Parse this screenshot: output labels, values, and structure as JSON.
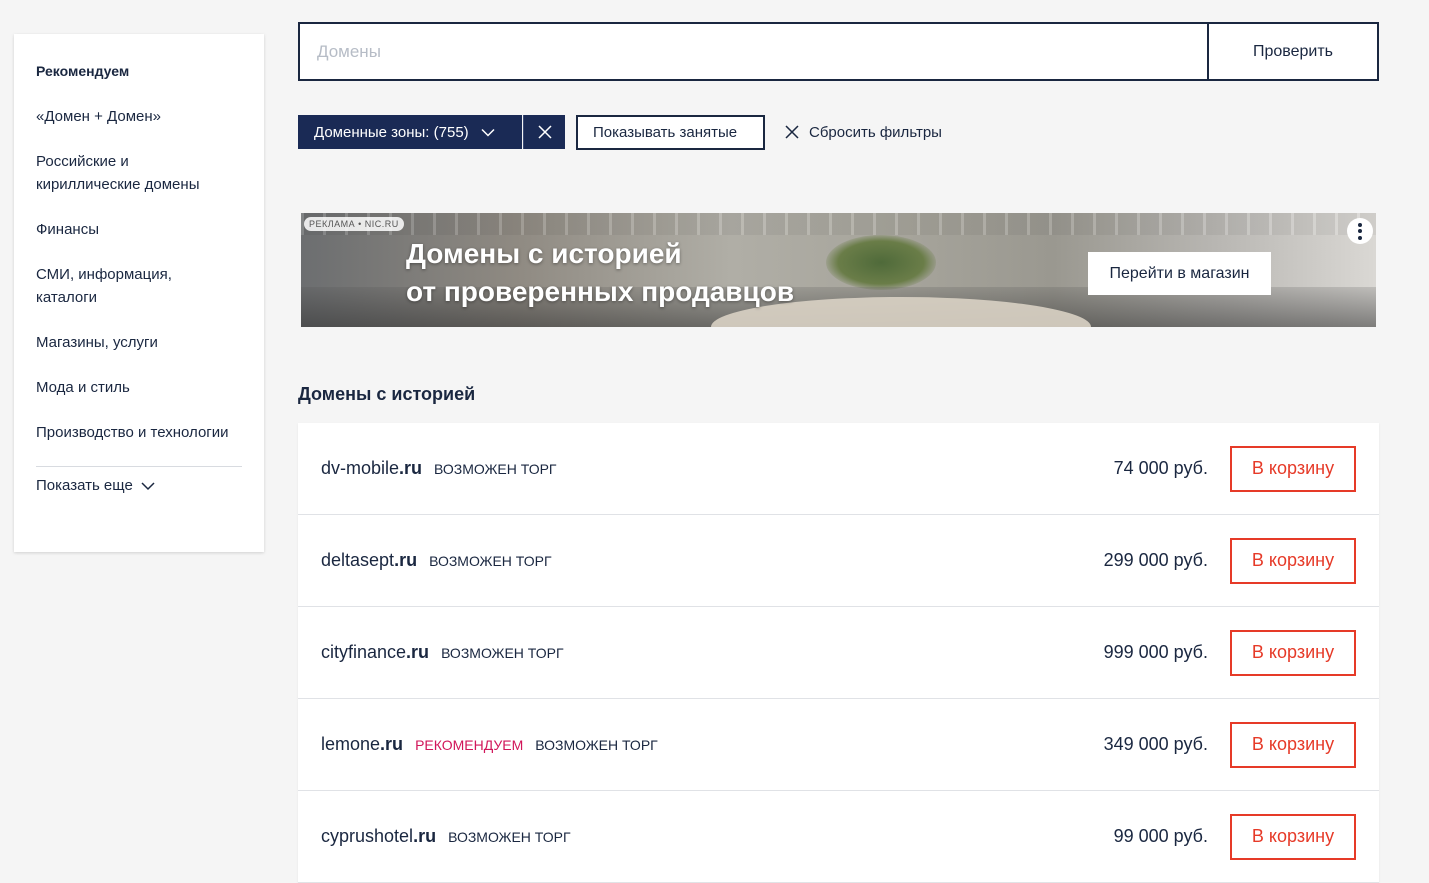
{
  "sidebar": {
    "items": [
      {
        "label": "Рекомендуем",
        "active": true
      },
      {
        "label": "«Домен + Домен»"
      },
      {
        "label": "Российские и кириллические домены"
      },
      {
        "label": "Финансы"
      },
      {
        "label": "СМИ, информация, каталоги"
      },
      {
        "label": "Магазины, услуги"
      },
      {
        "label": "Мода и стиль"
      },
      {
        "label": "Производство и технологии"
      }
    ],
    "more_label": "Показать еще"
  },
  "search": {
    "placeholder": "Домены",
    "value": "",
    "button_label": "Проверить"
  },
  "filters": {
    "zones_label": "Доменные зоны: (755)",
    "show_busy_label": "Показывать занятые",
    "reset_label": "Сбросить фильтры"
  },
  "banner": {
    "ad_label": "РЕКЛАМА • NIC.RU",
    "title_line1": "Домены с историей",
    "title_line2": "от проверенных продавцов",
    "button_label": "Перейти в магазин"
  },
  "section": {
    "title": "Домены с историей"
  },
  "domains": [
    {
      "name": "dv-mobile",
      "tld": ".ru",
      "tags": [
        "ВОЗМОЖЕН ТОРГ"
      ],
      "recommended": false,
      "price": "74 000 руб.",
      "cart_label": "В корзину"
    },
    {
      "name": "deltasept",
      "tld": ".ru",
      "tags": [
        "ВОЗМОЖЕН ТОРГ"
      ],
      "recommended": false,
      "price": "299 000 руб.",
      "cart_label": "В корзину"
    },
    {
      "name": "cityfinance",
      "tld": ".ru",
      "tags": [
        "ВОЗМОЖЕН ТОРГ"
      ],
      "recommended": false,
      "price": "999 000 руб.",
      "cart_label": "В корзину"
    },
    {
      "name": "lemone",
      "tld": ".ru",
      "tags": [
        "ВОЗМОЖЕН ТОРГ"
      ],
      "recommended": true,
      "recommended_label": "РЕКОМЕНДУЕМ",
      "price": "349 000 руб.",
      "cart_label": "В корзину"
    },
    {
      "name": "cyprushotel",
      "tld": ".ru",
      "tags": [
        "ВОЗМОЖЕН ТОРГ"
      ],
      "recommended": false,
      "price": "99 000 руб.",
      "cart_label": "В корзину"
    }
  ],
  "colors": {
    "navy": "#1a2a55",
    "text": "#1a2740",
    "cart_red": "#e63a28",
    "recommend_pink": "#d1165a"
  }
}
